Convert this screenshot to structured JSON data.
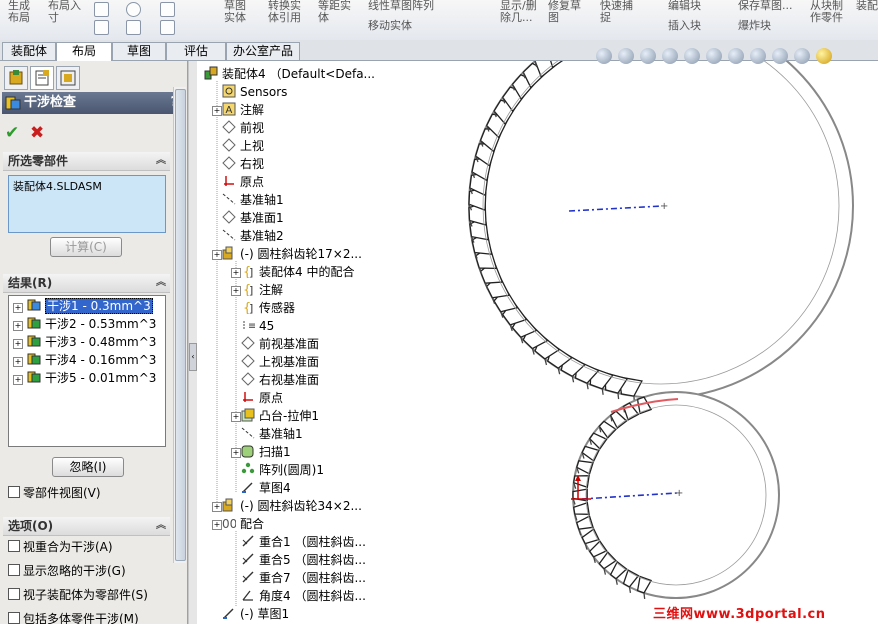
{
  "ribbon": {
    "groups": [
      {
        "label": "生成\n布局"
      },
      {
        "label": "布局入\n寸"
      },
      {
        "label": "草图\n实体"
      },
      {
        "label": "等距实\n体"
      },
      {
        "label": "转换实\n体引用"
      },
      {
        "label": "等距实\n体"
      },
      {
        "label": "线性草图阵列"
      },
      {
        "label": "移动实体"
      },
      {
        "label": "显示/删\n除几..."
      },
      {
        "label": "修复草\n图"
      },
      {
        "label": "快速捕\n捉"
      },
      {
        "label": "编辑块"
      },
      {
        "label": "插入块"
      },
      {
        "label": "保存草图..."
      },
      {
        "label": "爆炸块"
      },
      {
        "label": "从块制\n作零件"
      },
      {
        "label": "装配..."
      }
    ]
  },
  "tabs": [
    "装配体",
    "布局",
    "草图",
    "评估",
    "办公室产品"
  ],
  "active_tab": "布局",
  "panel": {
    "title": "干涉检查",
    "help": "?",
    "ok_icon": "check-icon",
    "cancel_icon": "x-icon",
    "selected_section": "所选零部件",
    "selected_item": "装配体4.SLDASM",
    "calc_button": "计算(C)",
    "results_section": "结果(R)",
    "results": [
      "干涉1 - 0.3mm^3",
      "干涉2 - 0.53mm^3",
      "干涉3 - 0.48mm^3",
      "干涉4 - 0.16mm^3",
      "干涉5 - 0.01mm^3"
    ],
    "ignore_button": "忽略(I)",
    "component_view": "零部件视图(V)",
    "options_section": "选项(O)",
    "options": [
      "视重合为干涉(A)",
      "显示忽略的干涉(G)",
      "视子装配体为零部件(S)",
      "包括多体零件干涉(M)"
    ]
  },
  "tree": {
    "root": "装配体4 （Default<Defa...",
    "items": [
      {
        "label": "Sensors",
        "icon": "sensor-icon"
      },
      {
        "label": "注解",
        "icon": "annotation-icon"
      },
      {
        "label": "前视",
        "icon": "plane-icon"
      },
      {
        "label": "上视",
        "icon": "plane-icon"
      },
      {
        "label": "右视",
        "icon": "plane-icon"
      },
      {
        "label": "原点",
        "icon": "origin-icon"
      },
      {
        "label": "基准轴1",
        "icon": "axis-icon"
      },
      {
        "label": "基准面1",
        "icon": "plane-icon"
      },
      {
        "label": "基准轴2",
        "icon": "axis-icon"
      },
      {
        "label": "(-) 圆柱斜齿轮17×2...",
        "icon": "part-icon"
      },
      {
        "label": "装配体4 中的配合",
        "icon": "folder-icon"
      },
      {
        "label": "注解",
        "icon": "folder-icon"
      },
      {
        "label": "传感器",
        "icon": "folder-icon"
      },
      {
        "label": "45",
        "icon": "material-icon"
      },
      {
        "label": "前视基准面",
        "icon": "plane-icon"
      },
      {
        "label": "上视基准面",
        "icon": "plane-icon"
      },
      {
        "label": "右视基准面",
        "icon": "plane-icon"
      },
      {
        "label": "原点",
        "icon": "origin-icon"
      },
      {
        "label": "凸台-拉伸1",
        "icon": "extrude-icon"
      },
      {
        "label": "基准轴1",
        "icon": "axis-icon"
      },
      {
        "label": "扫描1",
        "icon": "sweep-icon"
      },
      {
        "label": "阵列(圆周)1",
        "icon": "pattern-icon"
      },
      {
        "label": "草图4",
        "icon": "sketch-icon"
      },
      {
        "label": "(-) 圆柱斜齿轮34×2...",
        "icon": "part-icon"
      },
      {
        "label": "配合",
        "icon": "mates-icon"
      },
      {
        "label": "重合1 （圆柱斜齿...",
        "icon": "mate-icon"
      },
      {
        "label": "重合5 （圆柱斜齿...",
        "icon": "mate-icon"
      },
      {
        "label": "重合7 （圆柱斜齿...",
        "icon": "mate-icon"
      },
      {
        "label": "角度4 （圆柱斜齿...",
        "icon": "angle-mate-icon"
      },
      {
        "label": "(-) 草图1",
        "icon": "sketch-icon"
      }
    ]
  },
  "watermark": "三维网www.3dportal.cn",
  "colors": {
    "panel_title_bg": "#4a5670",
    "accent_blue": "#3366cc",
    "watermark_red": "#e01010",
    "ok_green": "#2e9b2e",
    "cancel_red": "#c81e1e"
  }
}
